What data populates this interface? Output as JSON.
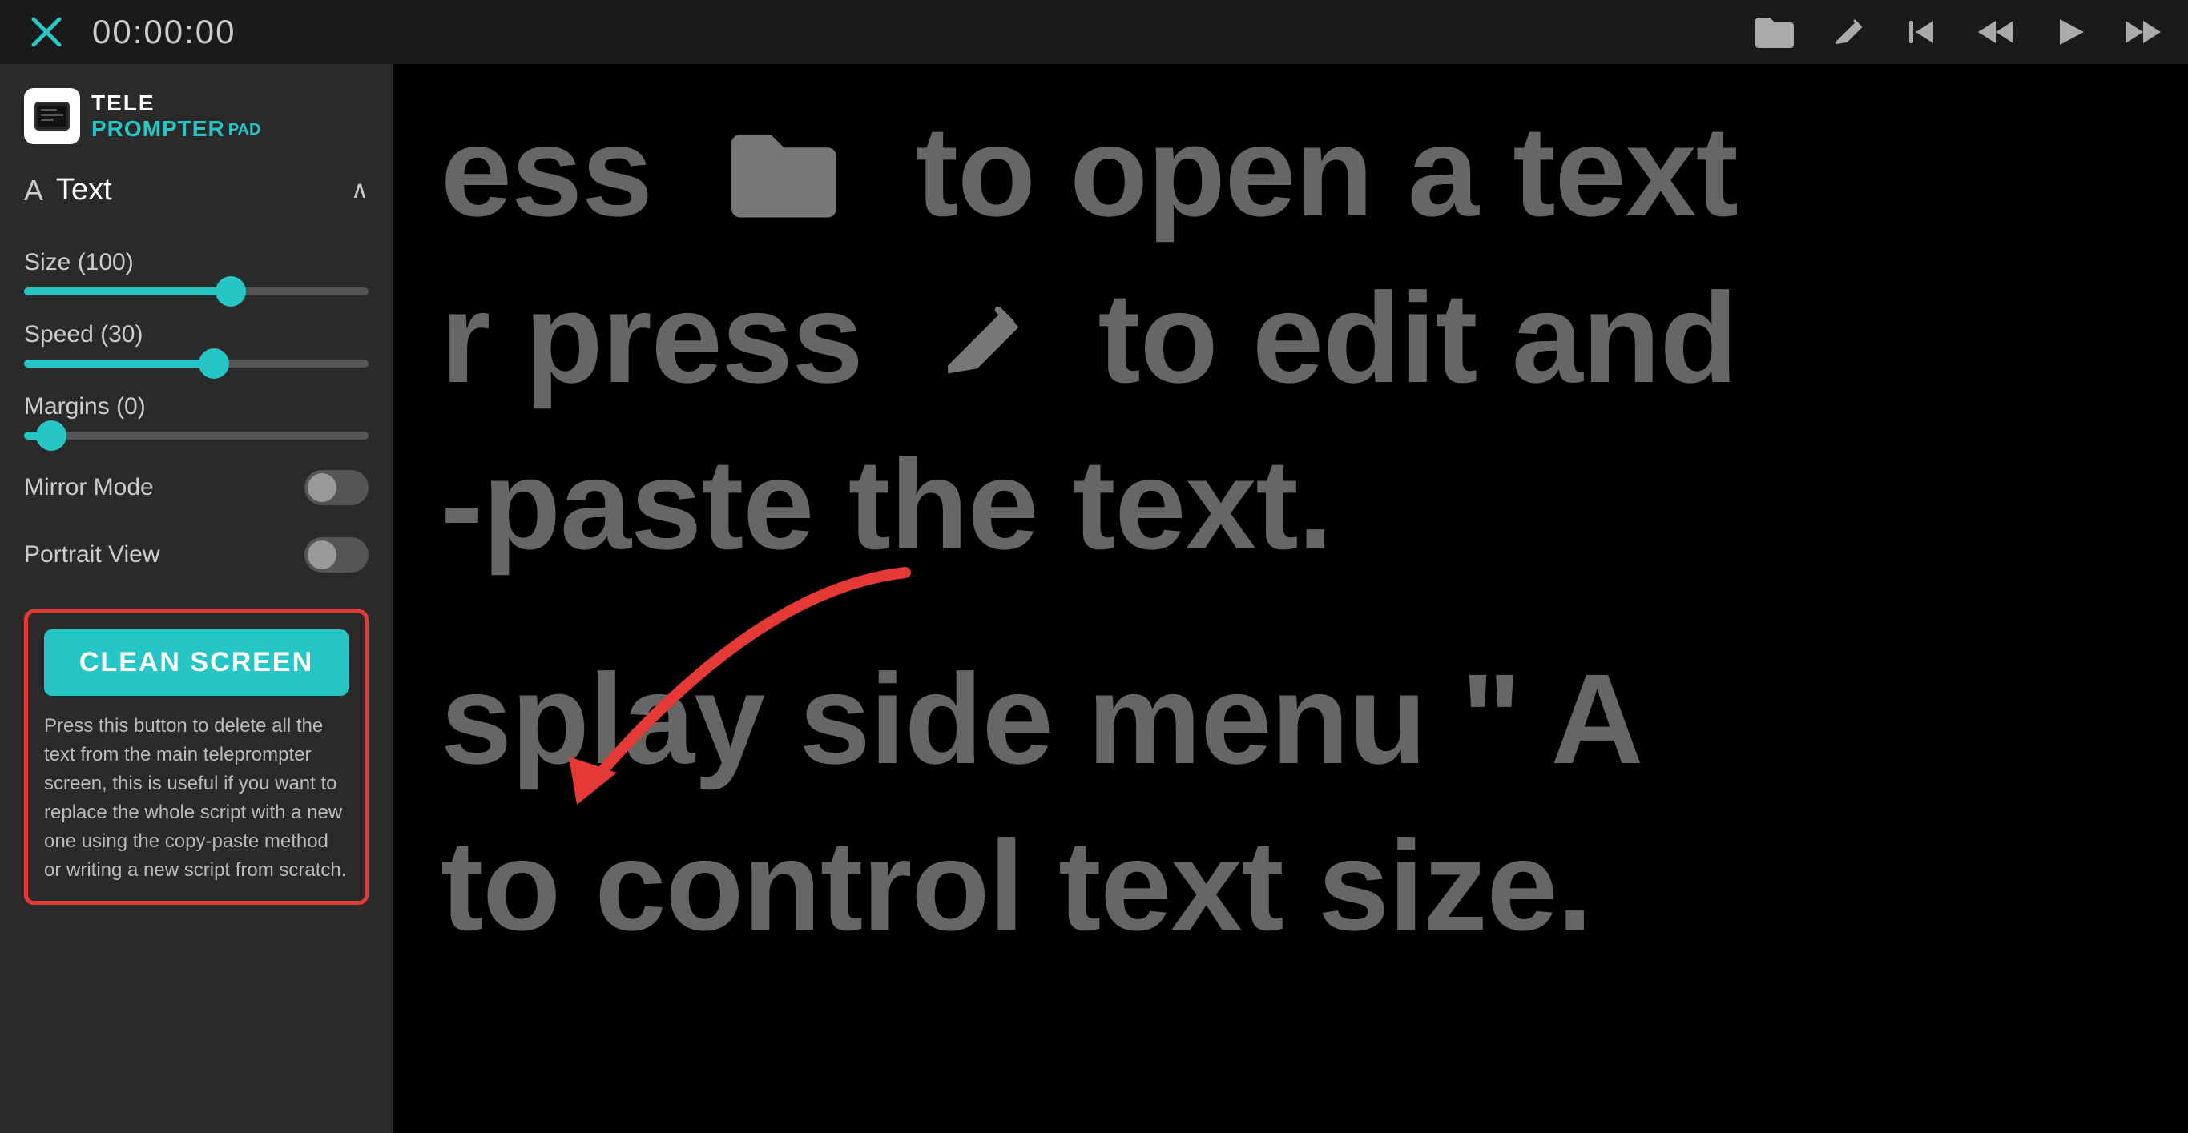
{
  "topbar": {
    "timer": "00:00:00",
    "close_label": "×"
  },
  "sidebar": {
    "section_title": "Text",
    "size_label": "Size (100)",
    "size_value": 100,
    "size_percent": 60,
    "speed_label": "Speed (30)",
    "speed_value": 30,
    "speed_percent": 55,
    "margins_label": "Margins (0)",
    "margins_value": 0,
    "margins_percent": 8,
    "mirror_mode_label": "Mirror Mode",
    "portrait_view_label": "Portrait View",
    "clean_screen_label": "CLEAN SCREEN",
    "clean_screen_desc": "Press this button to delete all the text from the main teleprompter screen, this is useful if you want to replace the whole script with a new one using the copy-paste method or writing a new script from scratch."
  },
  "teleprompter": {
    "line1": "ess  📂  to open a text",
    "line2": "r press  ✏️  to edit and",
    "line3": "-paste the text.",
    "line4": "splay side menu \" A",
    "line5": "to control text size."
  },
  "icons": {
    "close": "✕",
    "folder": "📂",
    "edit": "✏",
    "skip_start": "⏮",
    "rewind": "◀◀",
    "play": "▶",
    "fast_forward": "▶▶",
    "text_icon": "A",
    "chevron_up": "∧"
  }
}
